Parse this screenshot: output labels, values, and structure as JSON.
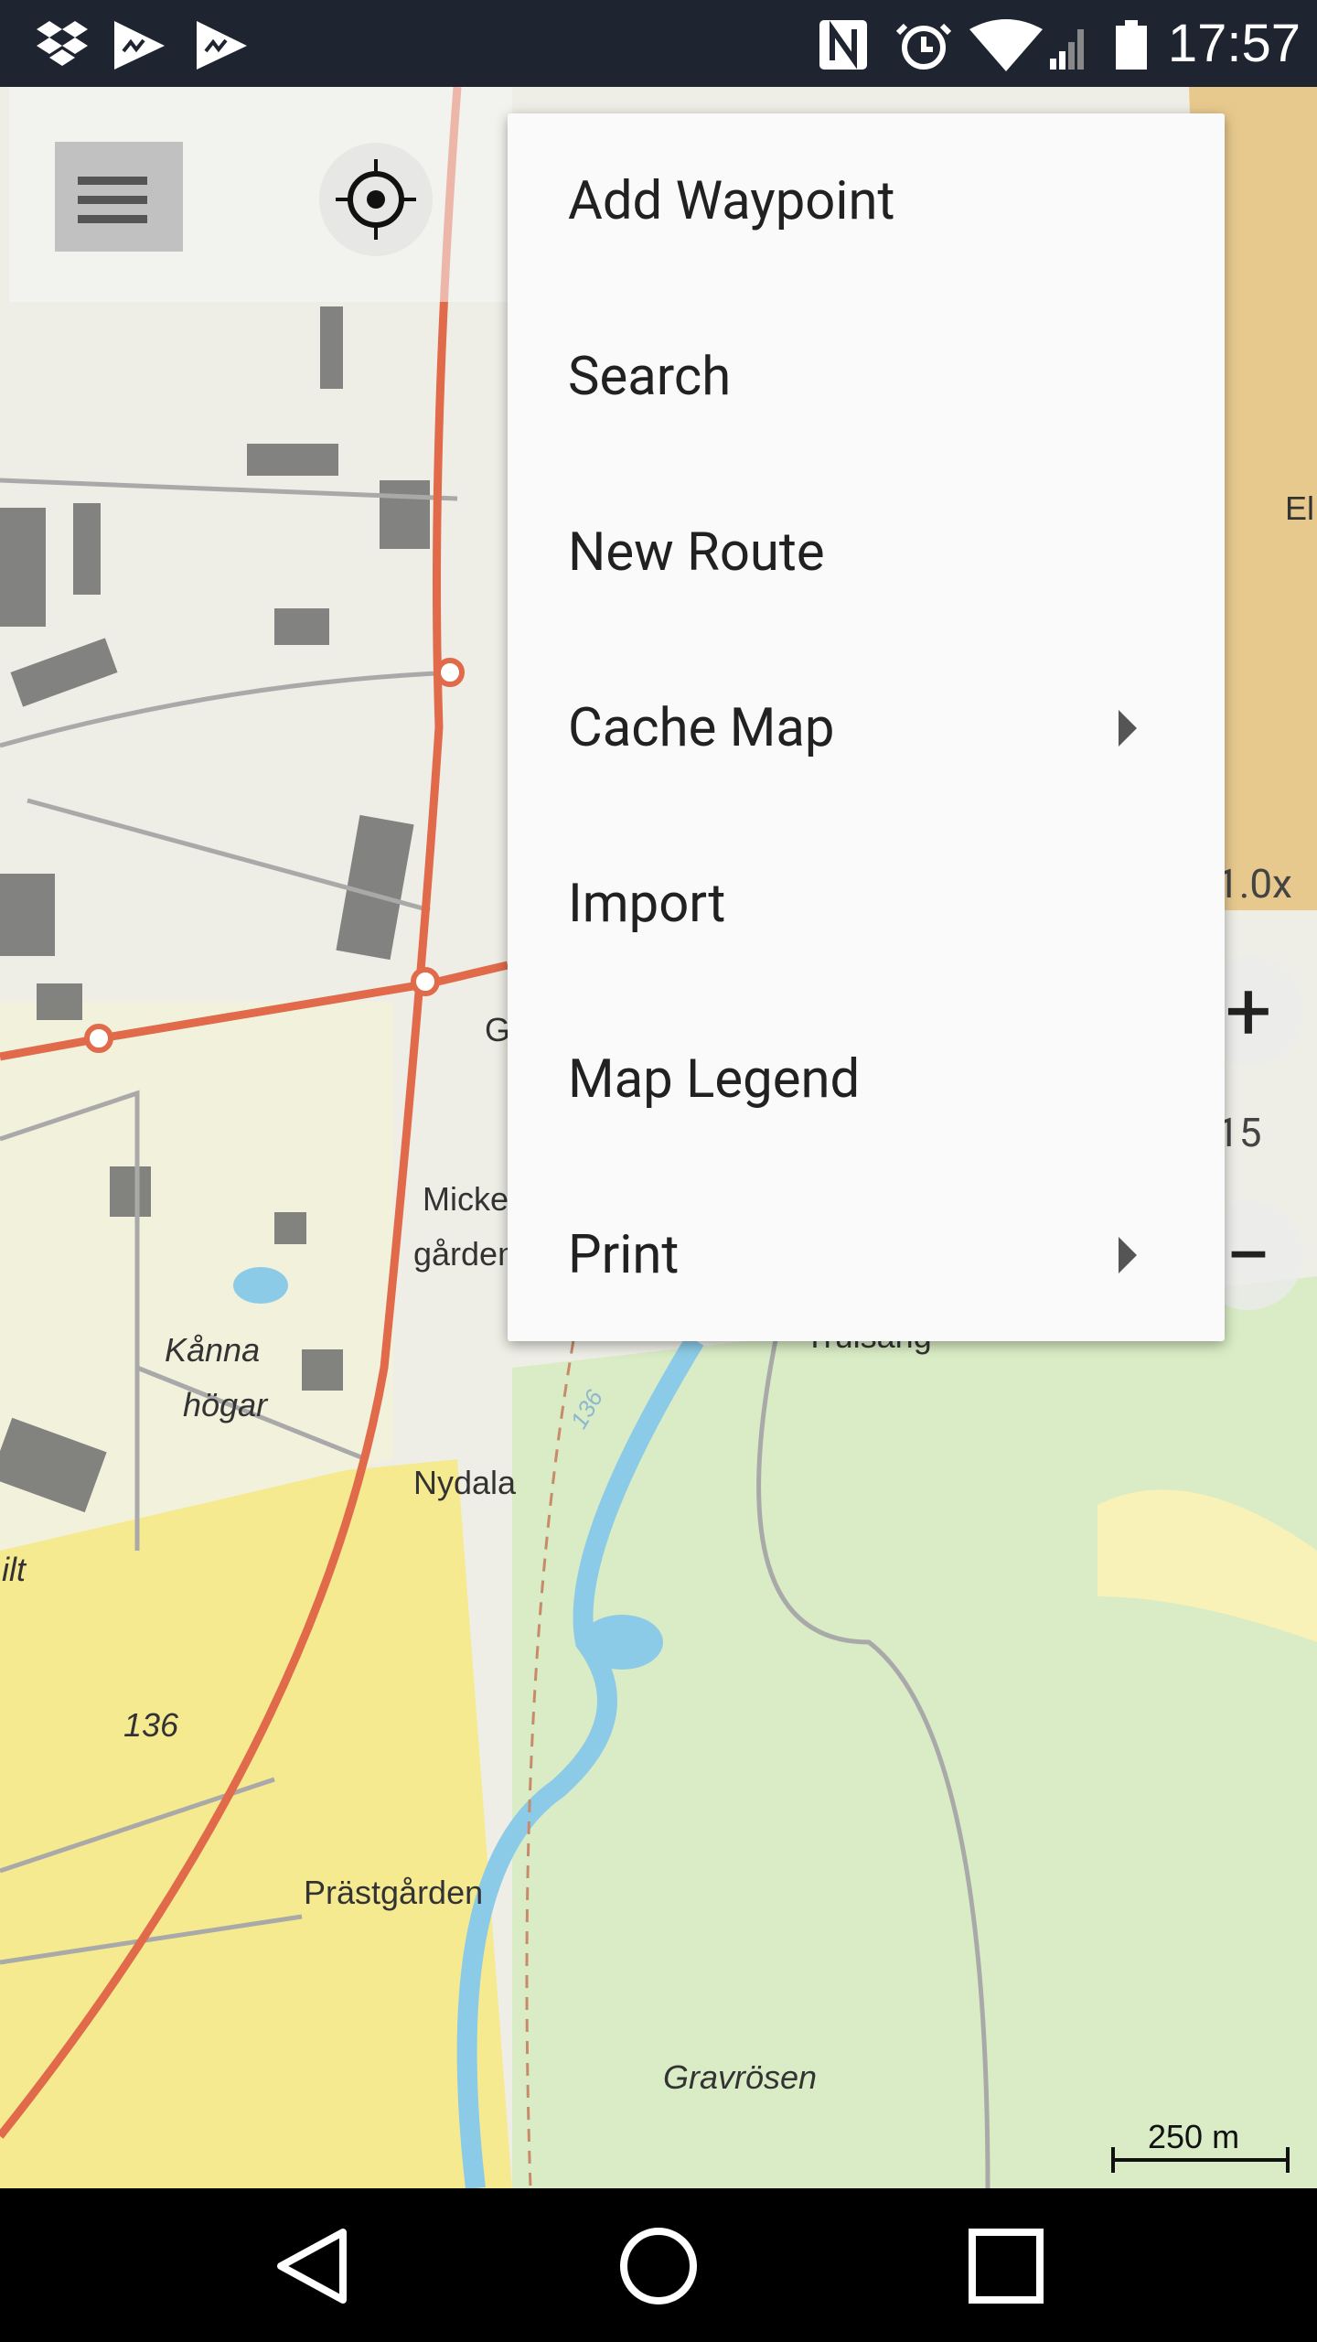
{
  "status_bar": {
    "time": "17:57",
    "left_icons": [
      "dropbox-icon",
      "gpx-app-icon",
      "gpx-app-icon"
    ],
    "right_icons": [
      "nfc-icon",
      "alarm-icon",
      "wifi-icon",
      "signal-icon",
      "battery-icon"
    ]
  },
  "toolbar": {
    "menu_icon": "hamburger-icon",
    "locate_icon": "crosshair-icon"
  },
  "menu": {
    "items": [
      {
        "label": "Add Waypoint",
        "submenu": false
      },
      {
        "label": "Search",
        "submenu": false
      },
      {
        "label": "New Route",
        "submenu": false
      },
      {
        "label": "Cache Map",
        "submenu": true
      },
      {
        "label": "Import",
        "submenu": false
      },
      {
        "label": "Map Legend",
        "submenu": false
      },
      {
        "label": "Print",
        "submenu": true
      }
    ]
  },
  "zoom": {
    "factor": "1.0x",
    "level": "15",
    "plus": "+",
    "minus": "−"
  },
  "map": {
    "labels": [
      "Micke",
      "gården",
      "Kånna",
      "högar",
      "Nydala",
      "136",
      "Prästgården",
      "Gravrösen",
      "Trulsäng",
      "El",
      "G",
      "ilt",
      "136"
    ],
    "scale": "250 m"
  },
  "nav_bar": {
    "icons": [
      "back-icon",
      "home-icon",
      "recents-icon"
    ]
  },
  "colors": {
    "status_bar": "#1e2430",
    "road": "#e06a4a",
    "water": "#8ccbe8",
    "forest": "#d6ebc2",
    "field": "#f7ea8c"
  }
}
